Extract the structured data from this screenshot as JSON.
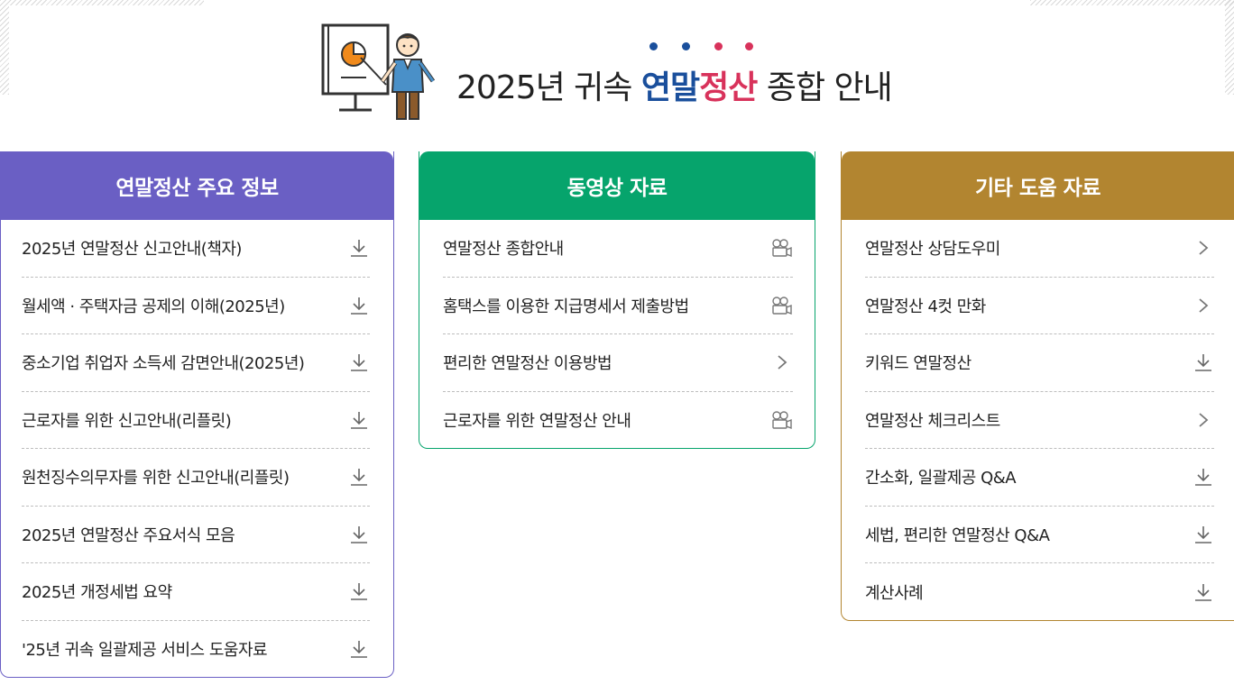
{
  "header": {
    "title_prefix": "2025년 귀속 ",
    "title_blue": "연말",
    "title_red": "정산",
    "title_suffix": " 종합 안내",
    "dot_colors": [
      "#1a4f9c",
      "#1a4f9c",
      "#d8325b",
      "#d8325b"
    ]
  },
  "colors": {
    "panel1": "#6a5fc4",
    "panel2": "#06a46c",
    "panel3": "#b28530"
  },
  "panels": [
    {
      "title": "연말정산 주요 정보",
      "items": [
        {
          "label": "2025년 연말정산 신고안내(책자)",
          "icon": "download-icon"
        },
        {
          "label": "월세액 · 주택자금 공제의 이해(2025년)",
          "icon": "download-icon"
        },
        {
          "label": "중소기업 취업자 소득세 감면안내(2025년)",
          "icon": "download-icon"
        },
        {
          "label": "근로자를 위한 신고안내(리플릿)",
          "icon": "download-icon"
        },
        {
          "label": "원천징수의무자를 위한 신고안내(리플릿)",
          "icon": "download-icon"
        },
        {
          "label": "2025년 연말정산 주요서식 모음",
          "icon": "download-icon"
        },
        {
          "label": "2025년 개정세법 요약",
          "icon": "download-icon"
        },
        {
          "label": "'25년 귀속 일괄제공 서비스 도움자료",
          "icon": "download-icon"
        }
      ]
    },
    {
      "title": "동영상 자료",
      "items": [
        {
          "label": "연말정산 종합안내",
          "icon": "video-camera-icon"
        },
        {
          "label": "홈택스를 이용한 지급명세서 제출방법",
          "icon": "video-camera-icon"
        },
        {
          "label": "편리한 연말정산 이용방법",
          "icon": "chevron-right-icon"
        },
        {
          "label": "근로자를 위한 연말정산 안내",
          "icon": "video-camera-icon"
        }
      ]
    },
    {
      "title": "기타 도움 자료",
      "items": [
        {
          "label": "연말정산 상담도우미",
          "icon": "chevron-right-icon"
        },
        {
          "label": "연말정산 4컷 만화",
          "icon": "chevron-right-icon"
        },
        {
          "label": "키워드 연말정산",
          "icon": "download-icon"
        },
        {
          "label": "연말정산 체크리스트",
          "icon": "chevron-right-icon"
        },
        {
          "label": "간소화, 일괄제공 Q&A",
          "icon": "download-icon"
        },
        {
          "label": "세법, 편리한 연말정산 Q&A",
          "icon": "download-icon"
        },
        {
          "label": "계산사례",
          "icon": "download-icon"
        }
      ]
    }
  ]
}
